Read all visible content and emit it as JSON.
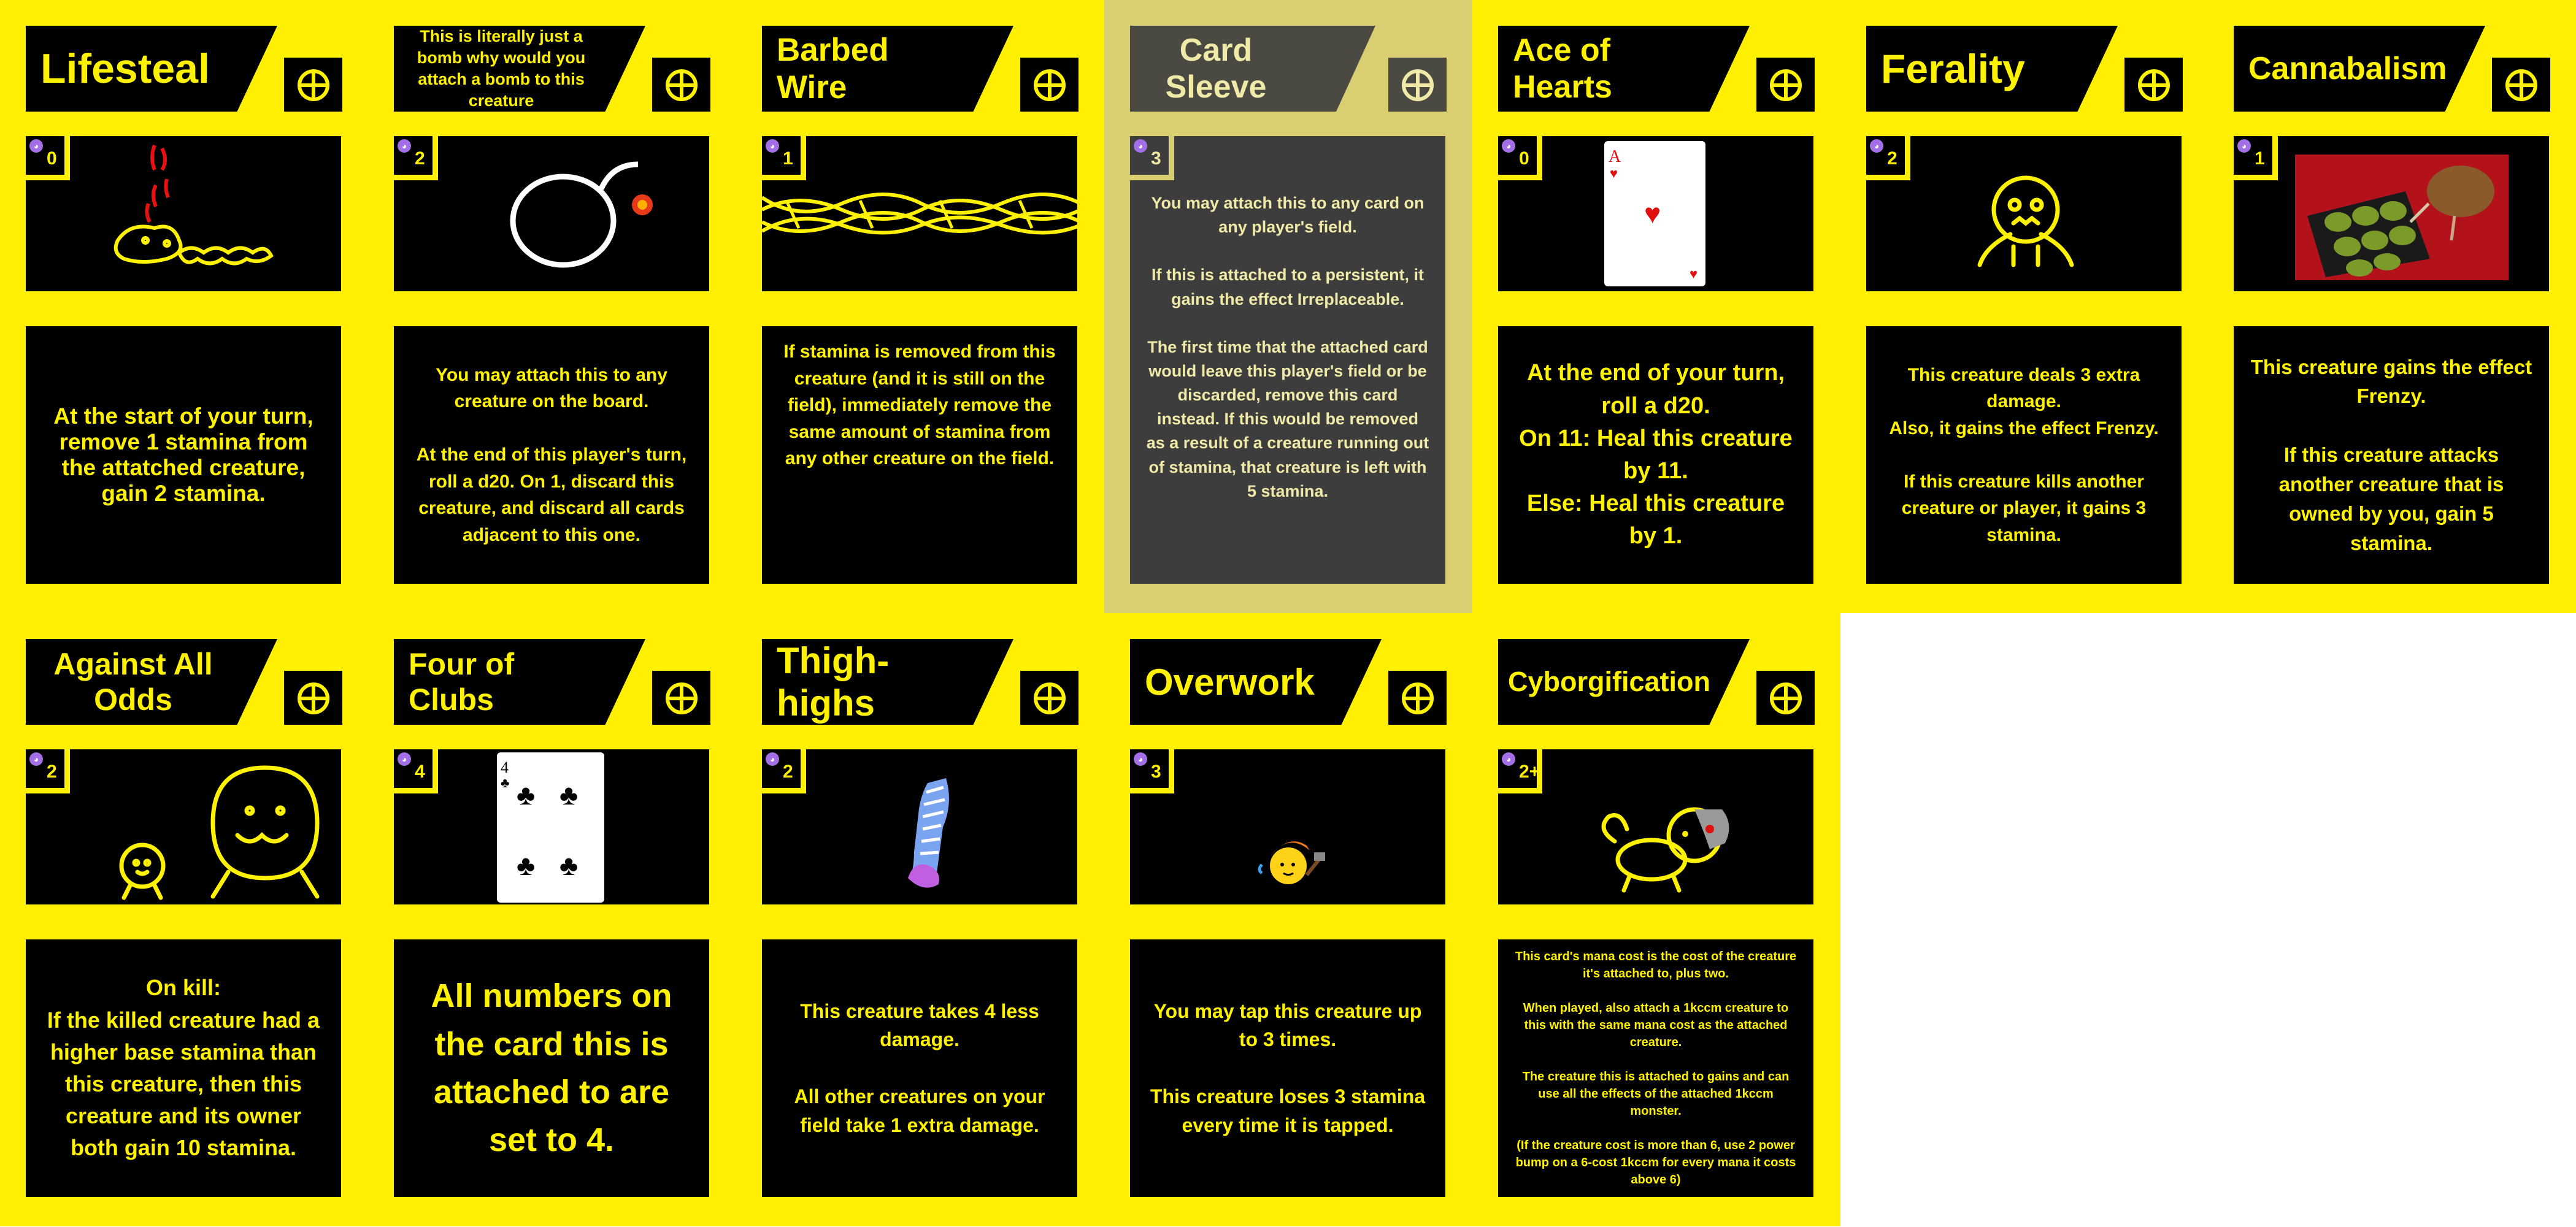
{
  "cards": {
    "lifesteal": {
      "title": "Lifesteal",
      "mana": "0",
      "text": "At the start of your turn, remove 1 stamina from the attatched creature, gain 2 stamina."
    },
    "bomb": {
      "title": "This is literally just a bomb why would you attach a bomb to this creature",
      "mana": "2",
      "text": "You may attach this to any creature on the board.\n\nAt the end of this player's turn, roll a d20. On 1, discard this creature, and discard all cards adjacent to this one."
    },
    "barbed": {
      "title": "Barbed Wire",
      "mana": "1",
      "text": "If stamina is removed from this creature (and it is still on the field), immediately remove the same amount of stamina from any other creature on the field."
    },
    "sleeve": {
      "title": "Card Sleeve",
      "mana": "3",
      "text": "You may attach this to any card on any player's field.\n\nIf this is attached to a persistent, it gains the effect Irreplaceable.\n\nThe first time that the attached card would leave this player's field or be discarded, remove this card instead. If this would be removed as a result of a creature running out of stamina, that creature is left with 5 stamina."
    },
    "ace": {
      "title": "Ace of Hearts",
      "mana": "0",
      "text": "At the end of your turn, roll a d20.\nOn 11: Heal this creature by 11.\nElse: Heal this creature by 1."
    },
    "ferality": {
      "title": "Ferality",
      "mana": "2",
      "text": "This creature deals 3 extra damage.\nAlso, it gains the effect Frenzy.\n\nIf this creature kills another creature or player, it gains 3 stamina."
    },
    "cannabalism": {
      "title": "Cannabalism",
      "mana": "1",
      "text": "This creature gains the effect Frenzy.\n\nIf this creature attacks another creature that is owned by you, gain 5 stamina."
    },
    "against": {
      "title": "Against All Odds",
      "mana": "2",
      "text": "On kill:\nIf the killed creature had a higher base stamina than this creature, then this creature and its owner both gain 10 stamina."
    },
    "clubs": {
      "title": "Four of Clubs",
      "mana": "4",
      "text": "All numbers on the card this is attached to are set to 4."
    },
    "thigh": {
      "title": "Thigh-highs",
      "mana": "2",
      "text": "This creature takes 4 less damage.\n\nAll other creatures on your field take 1 extra damage."
    },
    "overwork": {
      "title": "Overwork",
      "mana": "3",
      "text": "You may tap this creature up to 3 times.\n\nThis creature loses 3 stamina every time it is tapped."
    },
    "cyborg": {
      "title": "Cyborgification",
      "mana": "2+",
      "text": "This card's mana cost is the cost of the creature it's attached to, plus two.\n\nWhen played, also attach a 1kccm creature to this with the same mana cost as the attached creature.\n\nThe creature this is attached to gains and can use all the effects of the attached 1kccm monster.\n\n(If the creature cost is more than 6, use 2 power bump on a 6-cost 1kccm for every mana it costs above 6)"
    }
  },
  "colors": {
    "card": "#ffef00",
    "panel": "#000000",
    "text": "#fff200",
    "mana_icon": "#a36fe6"
  },
  "icons": {
    "mana": "mana-icon",
    "equip": "plus-circle-icon"
  }
}
